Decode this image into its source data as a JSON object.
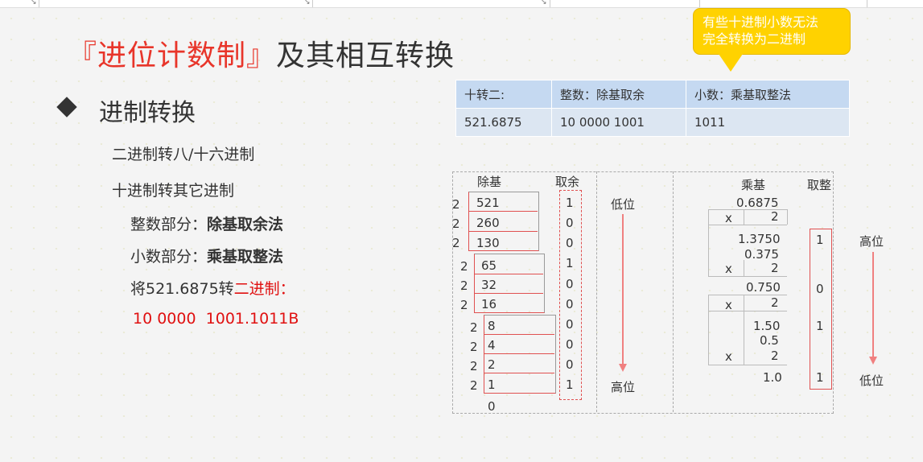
{
  "title": {
    "bracket_part": "『进位计数制』",
    "rest": "及其相互转换"
  },
  "section": {
    "heading": "进制转换"
  },
  "items": {
    "bin_to_oct_hex": "二进制转八/十六进制",
    "dec_to_other": "十进制转其它进制",
    "int_part_label": "整数部分：",
    "int_part_method": "除基取余法",
    "frac_part_label": "小数部分：",
    "frac_part_method": "乘基取整法",
    "example_prefix": "将521.6875转",
    "example_target": "二进制：",
    "example_result": "10 0000  1001.1011B"
  },
  "callout": {
    "line1": "有些十进制小数无法",
    "line2": "完全转换为二进制"
  },
  "table": {
    "headers": [
      "十转二:",
      "整数：除基取余",
      "小数：乘基取整法"
    ],
    "row": [
      "521.6875",
      "10 0000 1001",
      "1011"
    ]
  },
  "division": {
    "col_base": "除基",
    "col_rem": "取余",
    "base": "2",
    "quotients": [
      "521",
      "260",
      "130",
      "65",
      "32",
      "16",
      "8",
      "4",
      "2",
      "1"
    ],
    "remainders": [
      "1",
      "0",
      "0",
      "1",
      "0",
      "0",
      "0",
      "0",
      "0",
      "1"
    ],
    "final": "0",
    "arrow_top": "低位",
    "arrow_bottom": "高位"
  },
  "multiplication": {
    "col_base": "乘基",
    "col_int": "取整",
    "start": "0.6875",
    "times": "x",
    "base": "2",
    "results": [
      "1.3750",
      "0.750",
      "1.50",
      "1.0"
    ],
    "fractions": [
      "0.375",
      "0.5"
    ],
    "integers": [
      "1",
      "0",
      "1",
      "1"
    ],
    "arrow_top": "高位",
    "arrow_bottom": "低位"
  },
  "colors": {
    "accent_red": "#e8352a",
    "callout_yellow": "#ffd200",
    "table_head": "#c5d9f1",
    "table_body": "#dce6f2"
  }
}
